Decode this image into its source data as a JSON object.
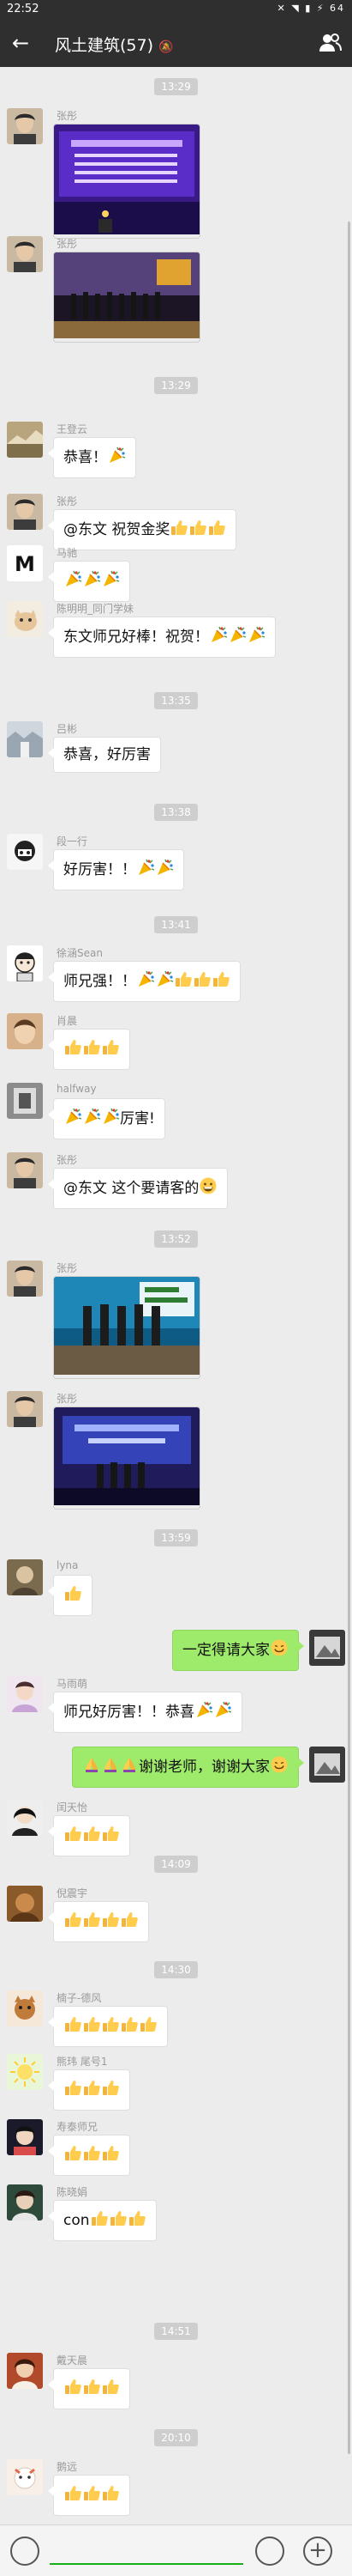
{
  "status": {
    "time": "22:52",
    "battery": "64"
  },
  "header": {
    "title": "风土建筑(57)"
  },
  "timestamps": [
    "13:29",
    "13:29",
    "13:35",
    "13:38",
    "13:41",
    "13:52",
    "13:59",
    "14:09",
    "14:30",
    "14:51",
    "20:10"
  ],
  "messages": [
    {
      "name": "张彤",
      "type": "image"
    },
    {
      "name": "张彤",
      "type": "image"
    },
    {
      "name": "王登云",
      "text": "恭喜！",
      "emoji": [
        "party"
      ]
    },
    {
      "name": "张彤",
      "text": "@东文 祝贺金奖",
      "emoji": [
        "thumb",
        "thumb",
        "thumb"
      ]
    },
    {
      "name": "马驰",
      "text": "",
      "emoji": [
        "party",
        "party",
        "party"
      ]
    },
    {
      "name": "陈明明_同门学妹",
      "text": "东文师兄好棒！祝贺！",
      "emoji": [
        "party",
        "party",
        "party"
      ]
    },
    {
      "name": "吕彬",
      "text": "恭喜，好厉害"
    },
    {
      "name": "段一行",
      "text": "好厉害！！",
      "emoji": [
        "party",
        "party"
      ]
    },
    {
      "name": "徐涵Sean",
      "text": "师兄强！！",
      "emoji": [
        "party",
        "party",
        "thumb",
        "thumb",
        "thumb"
      ]
    },
    {
      "name": "肖晨",
      "text": "",
      "emoji": [
        "thumb",
        "thumb",
        "thumb"
      ]
    },
    {
      "name": "halfway",
      "text_after": "厉害!",
      "emoji": [
        "party",
        "party",
        "party"
      ]
    },
    {
      "name": "张彤",
      "text": "@东文 这个要请客的",
      "emoji": [
        "grin"
      ]
    },
    {
      "name": "张彤",
      "type": "image"
    },
    {
      "name": "张彤",
      "type": "image"
    },
    {
      "name": "lyna",
      "text": "",
      "emoji": [
        "thumb"
      ]
    },
    {
      "name": "",
      "mine": true,
      "text": "一定得请大家",
      "emoji": [
        "smile"
      ]
    },
    {
      "name": "马雨萌",
      "text": "师兄好厉害！！恭喜",
      "emoji": [
        "party",
        "party"
      ]
    },
    {
      "name": "",
      "mine": true,
      "pre_emoji": [
        "pray",
        "pray",
        "pray"
      ],
      "text": "谢谢老师，谢谢大家",
      "emoji": [
        "smile"
      ]
    },
    {
      "name": "闰天怡",
      "text": "",
      "emoji": [
        "thumb",
        "thumb",
        "thumb"
      ]
    },
    {
      "name": "倪震宇",
      "text": "",
      "emoji": [
        "thumb",
        "thumb",
        "thumb",
        "thumb"
      ]
    },
    {
      "name": "楠子-德风",
      "text": "",
      "emoji": [
        "thumb",
        "thumb",
        "thumb",
        "thumb",
        "thumb"
      ]
    },
    {
      "name": "熊玮 尾号1",
      "text": "",
      "emoji": [
        "thumb",
        "thumb",
        "thumb"
      ]
    },
    {
      "name": "寿泰师兄",
      "text": "",
      "emoji": [
        "thumb",
        "thumb",
        "thumb"
      ]
    },
    {
      "name": "陈晓娟",
      "text": "con",
      "emoji": [
        "thumb",
        "thumb",
        "thumb"
      ]
    },
    {
      "name": "戴天晨",
      "text": "",
      "emoji": [
        "thumb",
        "thumb",
        "thumb"
      ]
    },
    {
      "name": "鹅远",
      "text": "",
      "emoji": [
        "thumb",
        "thumb",
        "thumb"
      ]
    }
  ],
  "colors": {
    "header": "#2f2f2f",
    "bubble_mine": "#9eea6a",
    "bubble_other": "#ffffff",
    "background": "#ececec"
  }
}
